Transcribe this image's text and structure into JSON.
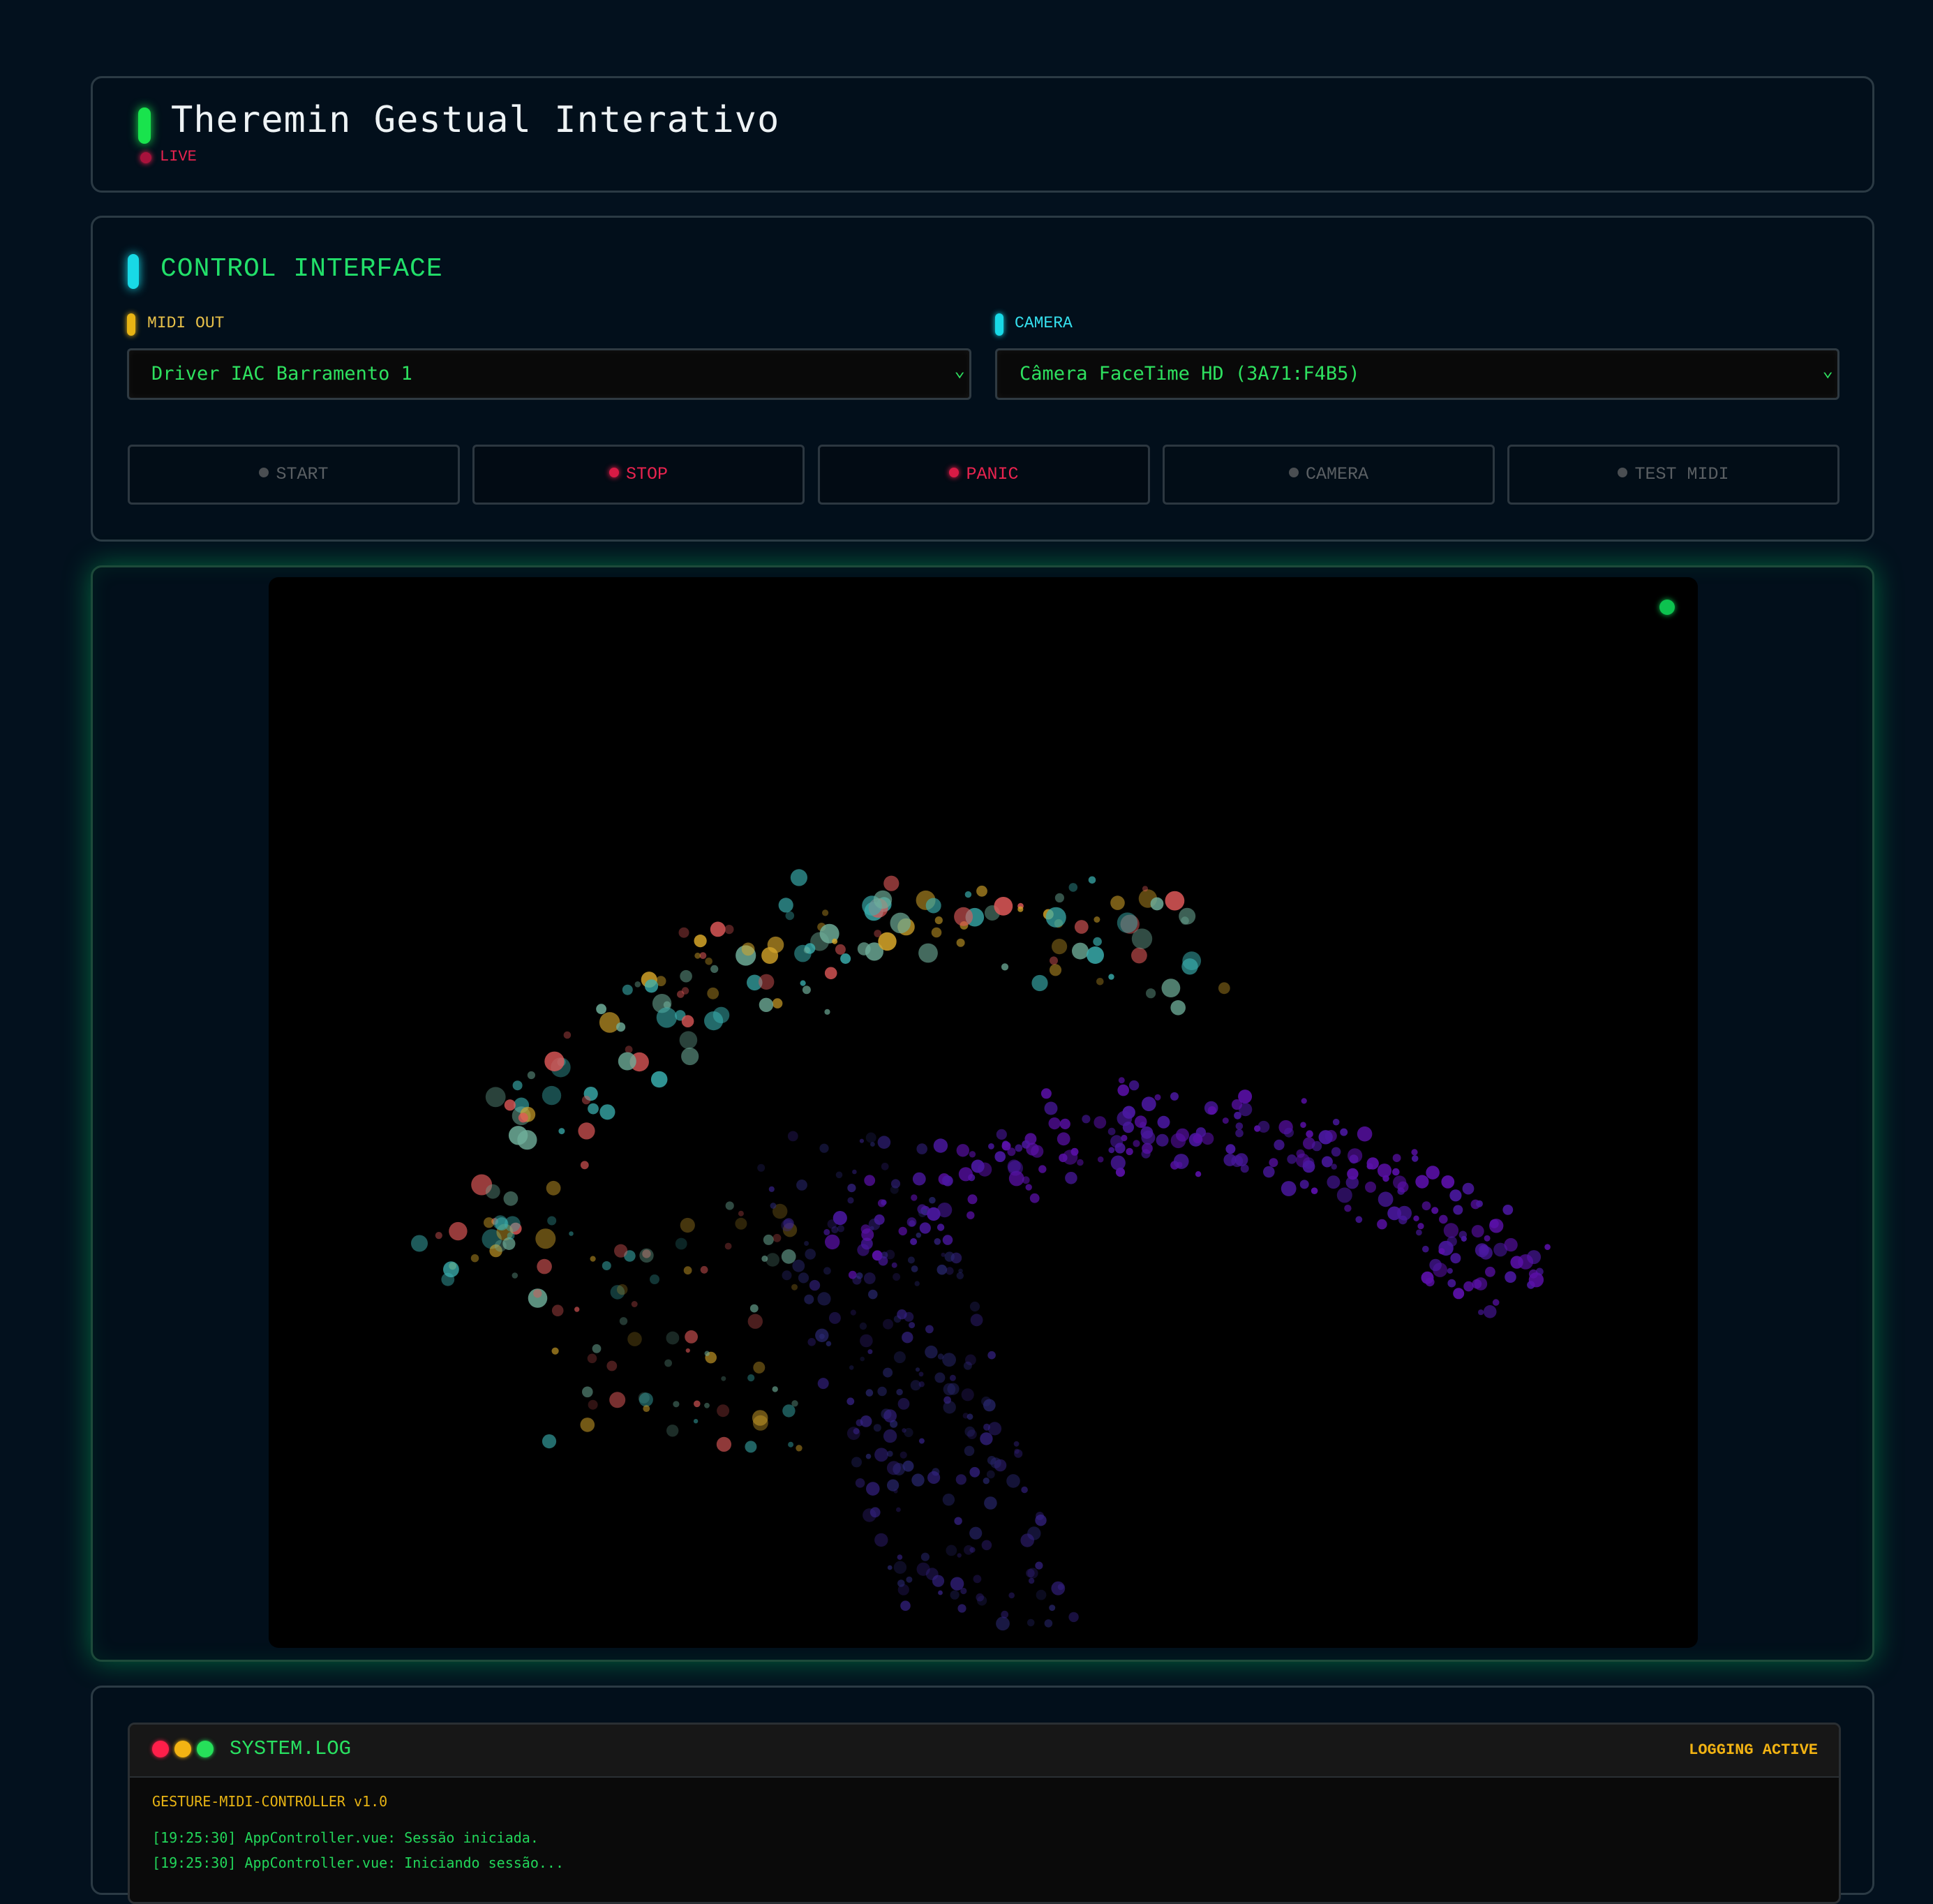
{
  "header": {
    "title": "Theremin Gestual Interativo",
    "live_label": "LIVE"
  },
  "controls": {
    "title": "CONTROL INTERFACE",
    "midi_out_label": "MIDI OUT",
    "midi_out_value": "Driver IAC Barramento 1",
    "camera_label": "CAMERA",
    "camera_value": "Câmera FaceTime HD (3A71:F4B5)",
    "buttons": [
      {
        "label": "START",
        "active": false
      },
      {
        "label": "STOP",
        "active": true
      },
      {
        "label": "PANIC",
        "active": true
      },
      {
        "label": "CAMERA",
        "active": false
      },
      {
        "label": "TEST MIDI",
        "active": false
      }
    ]
  },
  "visualizer": {
    "status": "active",
    "colors": {
      "warm": [
        "#e35a5a",
        "#d9a82a",
        "#3ab0b0",
        "#6fae9a"
      ],
      "cool": [
        "#5a10a8",
        "#4a18a0",
        "#3a2590",
        "#2c2a78"
      ],
      "status_led": "#0dc24f"
    }
  },
  "log": {
    "title": "SYSTEM.LOG",
    "status": "LOGGING ACTIVE",
    "version": "GESTURE-MIDI-CONTROLLER v1.0",
    "lines": [
      "[19:25:30] AppController.vue: Sessão iniciada.",
      "[19:25:30] AppController.vue: Iniciando sessão..."
    ]
  },
  "colors": {
    "background": "#03111e",
    "accent_green": "#22e06a",
    "accent_red": "#e8234f",
    "accent_yellow": "#e8b414",
    "accent_cyan": "#18d9e6"
  }
}
